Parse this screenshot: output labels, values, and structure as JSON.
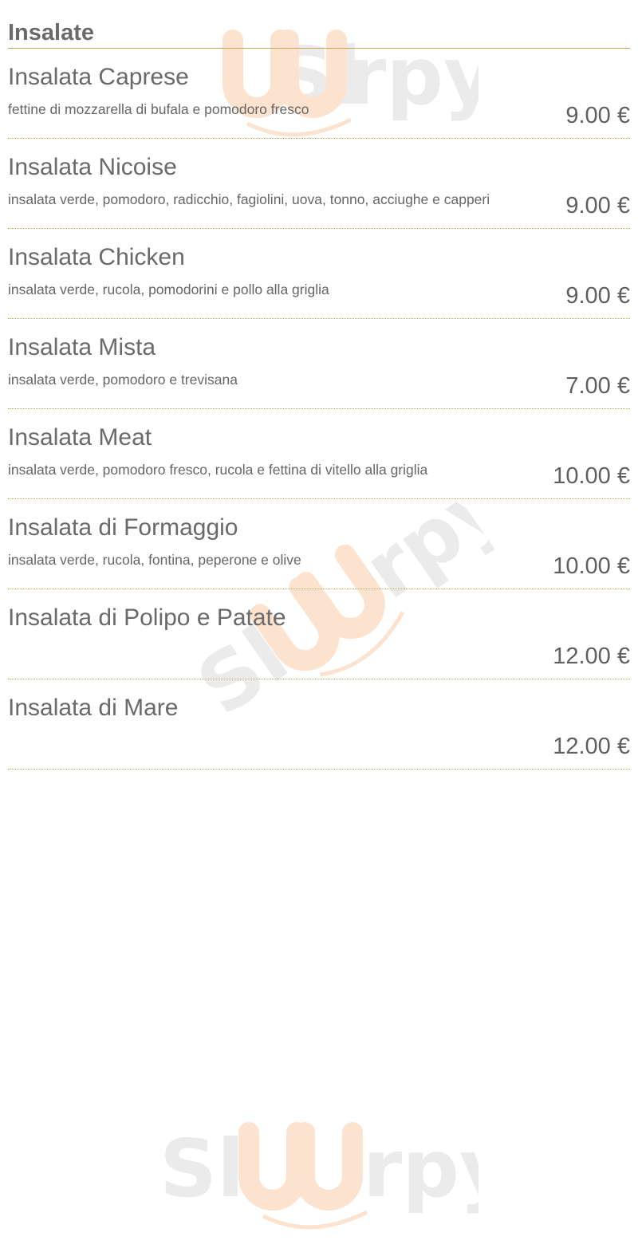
{
  "section": {
    "title": "Insalate"
  },
  "watermark": {
    "text": "Sluurpy"
  },
  "items": [
    {
      "name": "Insalata Caprese",
      "description": "fettine di mozzarella di bufala e pomodoro fresco",
      "price": "9.00 €"
    },
    {
      "name": "Insalata Nicoise",
      "description": "insalata verde, pomodoro, radicchio, fagiolini, uova, tonno, acciughe e capperi",
      "price": "9.00 €"
    },
    {
      "name": "Insalata Chicken",
      "description": "insalata verde, rucola, pomodorini e pollo alla griglia",
      "price": "9.00 €"
    },
    {
      "name": "Insalata Mista",
      "description": "insalata verde, pomodoro e trevisana",
      "price": "7.00 €"
    },
    {
      "name": "Insalata Meat",
      "description": "insalata verde, pomodoro fresco, rucola e fettina di vitello alla griglia",
      "price": "10.00 €"
    },
    {
      "name": "Insalata di Formaggio",
      "description": "insalata verde, rucola, fontina, peperone e olive",
      "price": "10.00 €"
    },
    {
      "name": "Insalata di Polipo e Patate",
      "description": "",
      "price": "12.00 €"
    },
    {
      "name": "Insalata di Mare",
      "description": "",
      "price": "12.00 €"
    }
  ],
  "colors": {
    "accent": "#c9a85c",
    "text": "#5f5f5f",
    "watermark_grey": "#ebebeb",
    "watermark_orange": "#fbe3cf"
  }
}
